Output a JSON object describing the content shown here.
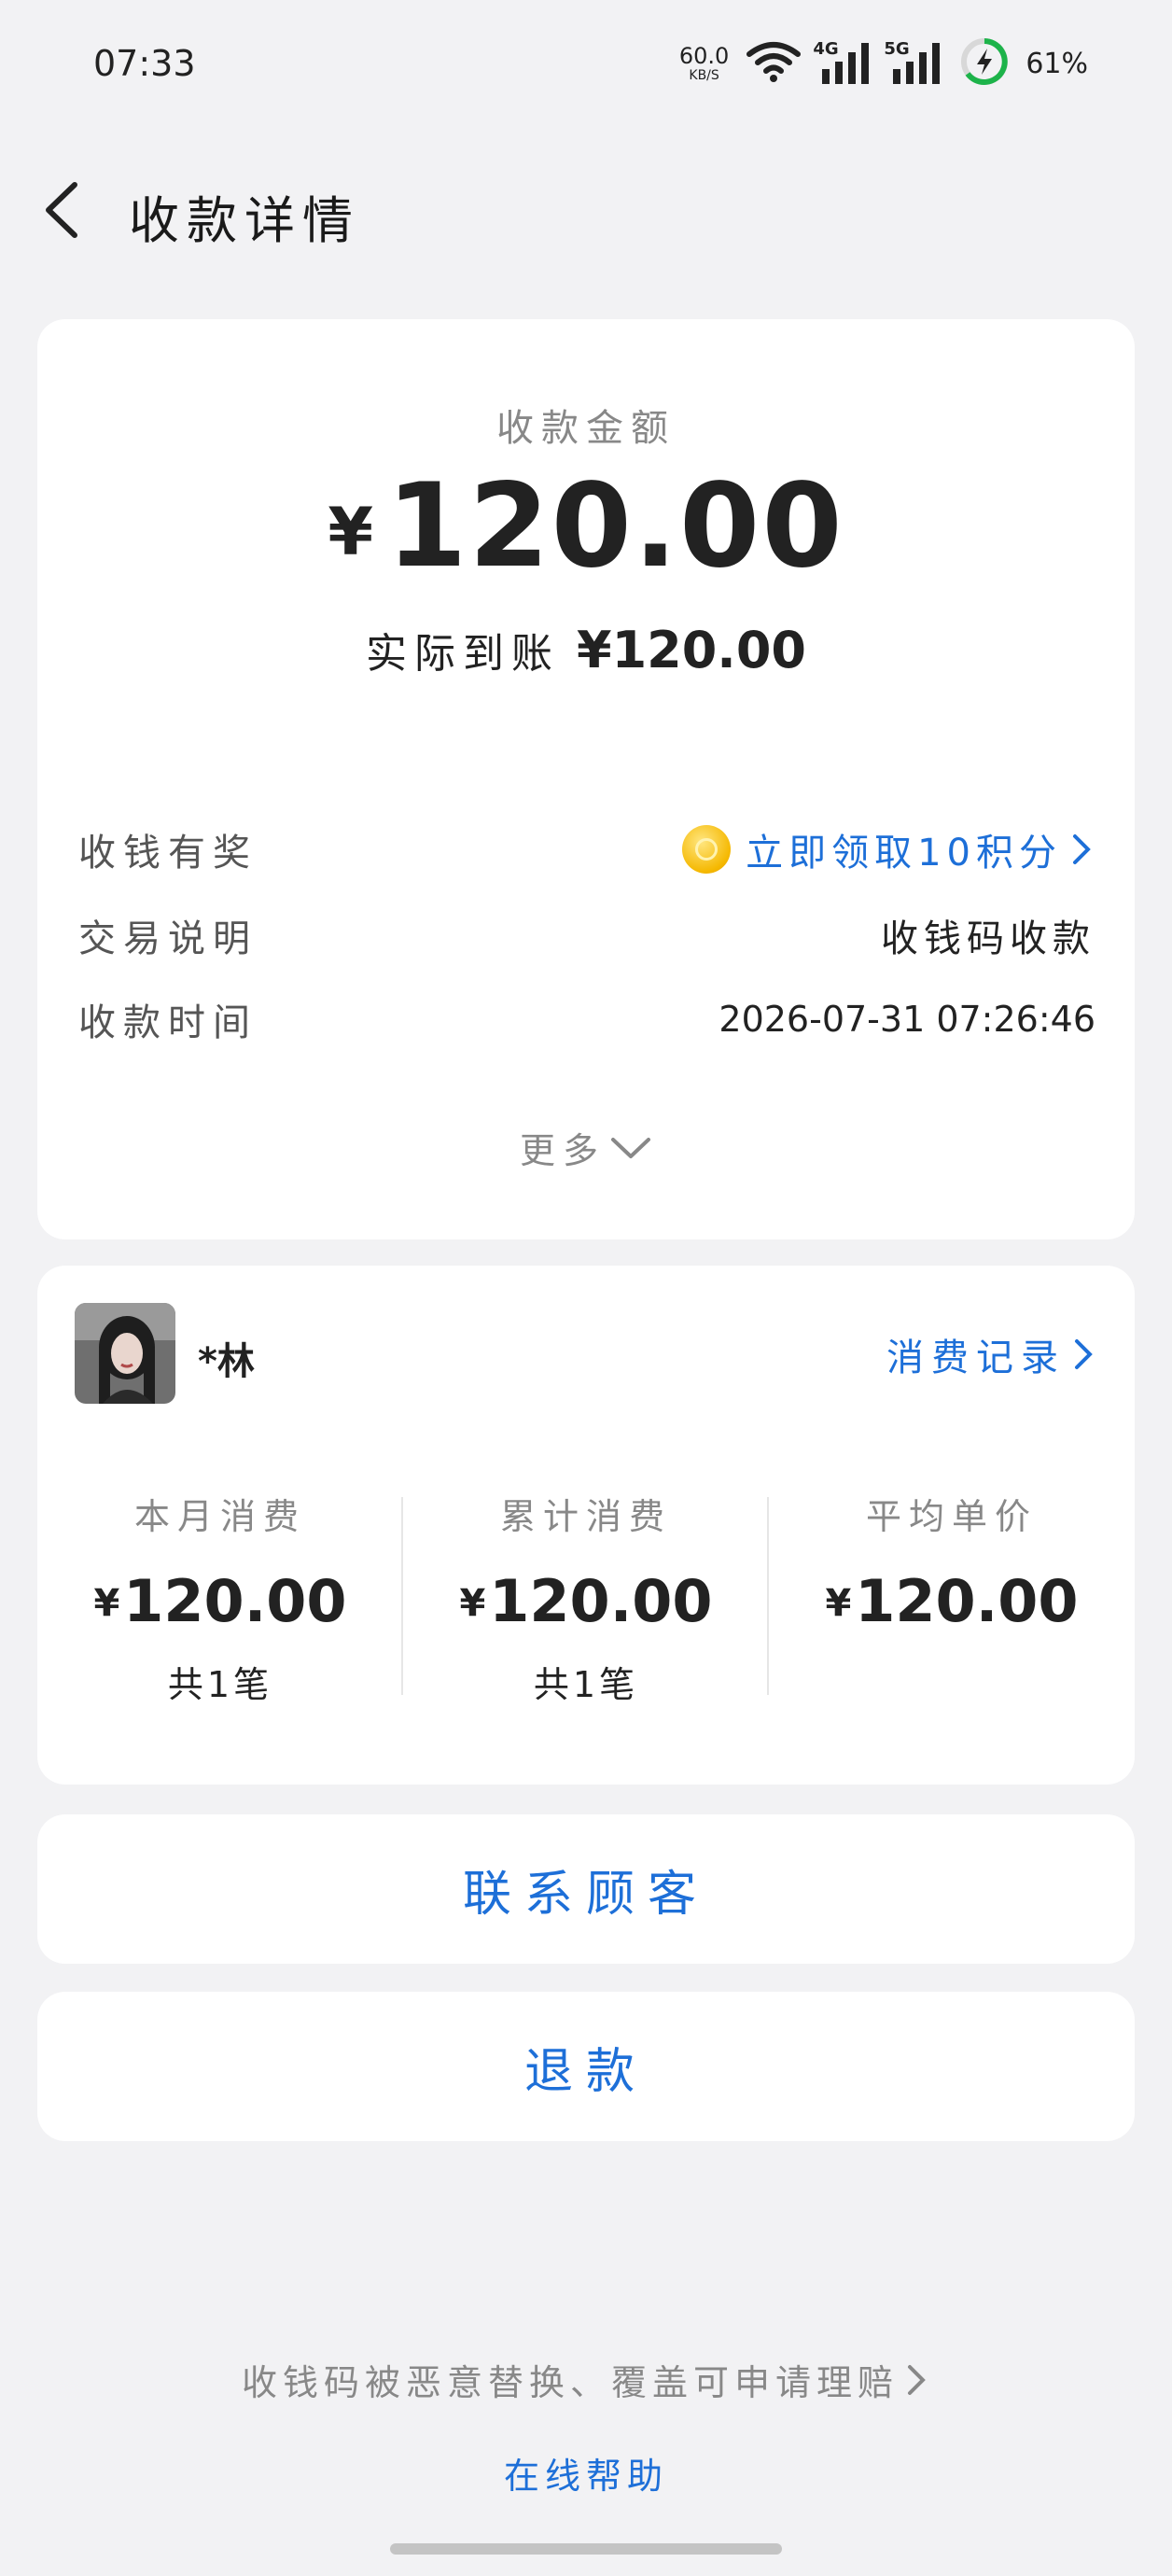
{
  "status_bar": {
    "time": "07:33",
    "net_speed": "60.0",
    "net_unit": "KB/S",
    "sig1_tag": "4G",
    "sig2_tag": "5G",
    "battery": "61%"
  },
  "nav": {
    "title": "收款详情"
  },
  "summary": {
    "amount_label": "收款金额",
    "currency": "¥",
    "amount": "120.00",
    "actual_label": "实际到账",
    "actual_value": "¥120.00",
    "rows": [
      {
        "key": "收钱有奖",
        "value": "立即领取10积分"
      },
      {
        "key": "交易说明",
        "value": "收钱码收款"
      },
      {
        "key": "收款时间",
        "value": "2026-07-31 07:26:46"
      }
    ],
    "more": "更多"
  },
  "customer": {
    "name": "*林",
    "record_link": "消费记录",
    "stats": [
      {
        "label": "本月消费",
        "currency": "¥",
        "value": "120.00",
        "count": "共1笔"
      },
      {
        "label": "累计消费",
        "currency": "¥",
        "value": "120.00",
        "count": "共1笔"
      },
      {
        "label": "平均单价",
        "currency": "¥",
        "value": "120.00"
      }
    ]
  },
  "actions": {
    "contact": "联系顾客",
    "refund": "退款"
  },
  "footer": {
    "claim": "收钱码被恶意替换、覆盖可申请理赔",
    "help": "在线帮助"
  },
  "colors": {
    "accent": "#1d6fd8",
    "background": "#f2f2f4"
  }
}
